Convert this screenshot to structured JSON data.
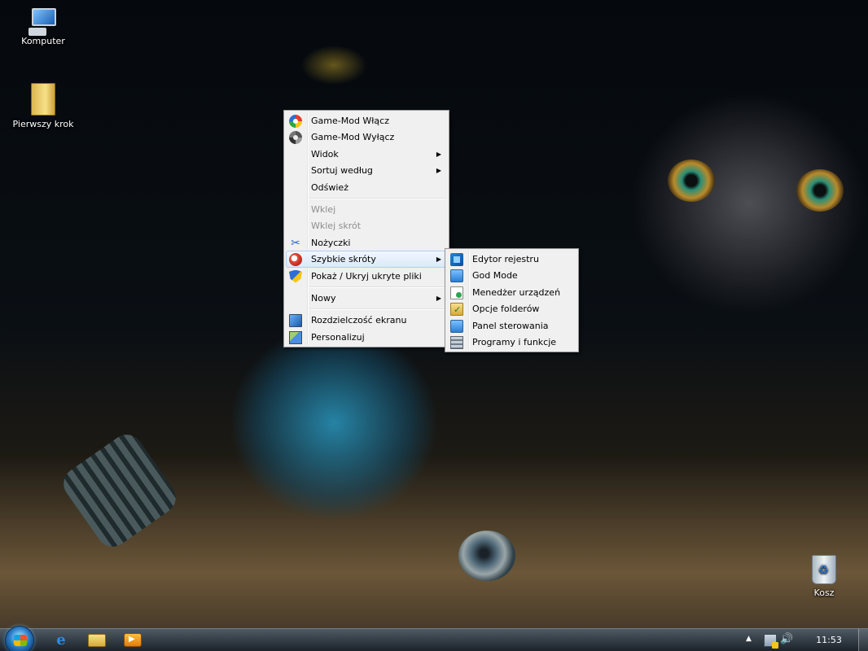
{
  "desktop": {
    "icons": [
      {
        "label": "Komputer",
        "icon": "computer-icon"
      },
      {
        "label": "Pierwszy krok",
        "icon": "folder-icon"
      },
      {
        "label": "Kosz",
        "icon": "recycle-bin-icon"
      }
    ]
  },
  "context_menu": {
    "items": [
      {
        "label": "Game-Mod Włącz",
        "icon": "game-mode-on-icon",
        "disabled": false,
        "submenu": false
      },
      {
        "label": "Game-Mod Wyłącz",
        "icon": "game-mode-off-icon",
        "disabled": false,
        "submenu": false
      },
      {
        "label": "Widok",
        "submenu": true
      },
      {
        "label": "Sortuj według",
        "submenu": true
      },
      {
        "label": "Odśwież",
        "submenu": false
      },
      {
        "label": "Wklej",
        "disabled": true
      },
      {
        "label": "Wklej skrót",
        "disabled": true
      },
      {
        "label": "Nożyczki",
        "icon": "scissors-icon"
      },
      {
        "label": "Szybkie skróty",
        "icon": "shortcuts-icon",
        "submenu": true,
        "highlighted": true
      },
      {
        "label": "Pokaż / Ukryj ukryte pliki",
        "icon": "shield-icon"
      },
      {
        "label": "Nowy",
        "submenu": true
      },
      {
        "label": "Rozdzielczość ekranu",
        "icon": "monitor-icon"
      },
      {
        "label": "Personalizuj",
        "icon": "personalize-icon"
      }
    ],
    "arrow": "▶"
  },
  "submenu": {
    "items": [
      {
        "label": "Edytor rejestru",
        "icon": "registry-editor-icon"
      },
      {
        "label": "God Mode",
        "icon": "control-panel-icon"
      },
      {
        "label": "Menedżer urządzeń",
        "icon": "device-manager-icon"
      },
      {
        "label": "Opcje folderów",
        "icon": "folder-options-icon"
      },
      {
        "label": "Panel sterowania",
        "icon": "control-panel-icon"
      },
      {
        "label": "Programy i funkcje",
        "icon": "programs-icon"
      }
    ]
  },
  "taskbar": {
    "clock": "11:53",
    "tray_arrow": "▲",
    "pinned": [
      "internet-explorer-icon",
      "explorer-icon",
      "media-player-icon"
    ]
  },
  "colors": {
    "menu_bg": "#f0f0f0",
    "menu_highlight": "#dbe9f8",
    "menu_highlight_border": "#aecff7",
    "disabled_text": "#8d8d8d"
  }
}
